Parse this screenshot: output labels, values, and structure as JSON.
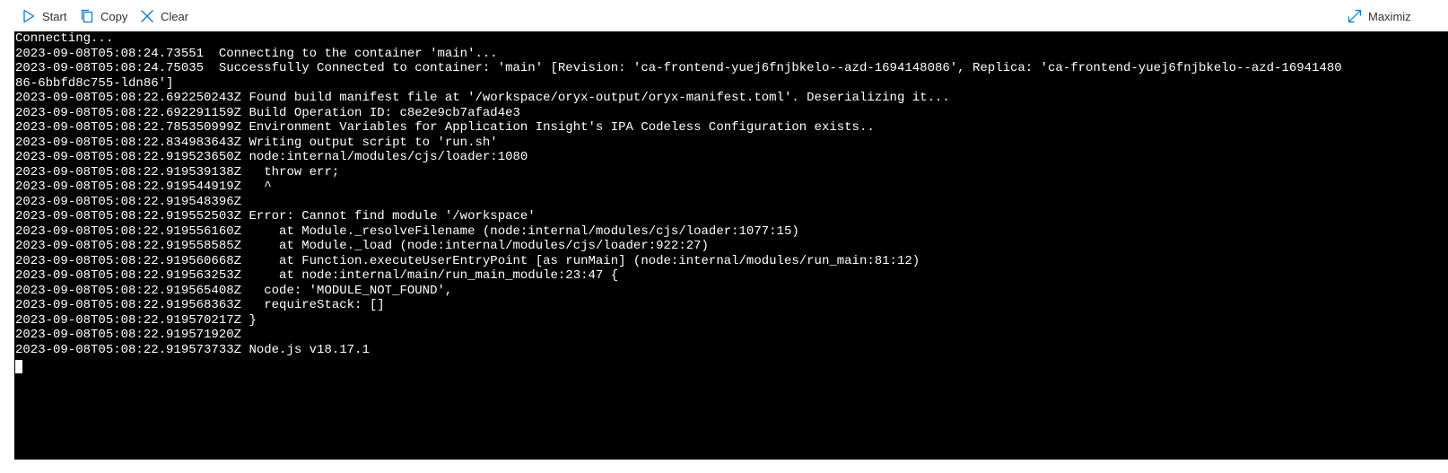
{
  "toolbar": {
    "start_label": "Start",
    "copy_label": "Copy",
    "clear_label": "Clear",
    "maximize_label": "Maximiz"
  },
  "icons": {
    "start": "play-icon",
    "copy": "copy-icon",
    "clear": "close-icon",
    "maximize": "expand-icon"
  },
  "colors": {
    "accent": "#0078d4",
    "console_background": "#000000",
    "console_text": "#ffffff"
  },
  "console": {
    "lines": [
      "Connecting...",
      "2023-09-08T05:08:24.73551  Connecting to the container 'main'...",
      "2023-09-08T05:08:24.75035  Successfully Connected to container: 'main' [Revision: 'ca-frontend-yuej6fnjbkelo--azd-1694148086', Replica: 'ca-frontend-yuej6fnjbkelo--azd-16941480",
      "86-6bbfd8c755-ldn86']",
      "2023-09-08T05:08:22.692250243Z Found build manifest file at '/workspace/oryx-output/oryx-manifest.toml'. Deserializing it...",
      "2023-09-08T05:08:22.692291159Z Build Operation ID: c8e2e9cb7afad4e3",
      "2023-09-08T05:08:22.785350999Z Environment Variables for Application Insight's IPA Codeless Configuration exists..",
      "2023-09-08T05:08:22.834983643Z Writing output script to 'run.sh'",
      "2023-09-08T05:08:22.919523650Z node:internal/modules/cjs/loader:1080",
      "2023-09-08T05:08:22.919539138Z   throw err;",
      "2023-09-08T05:08:22.919544919Z   ^",
      "2023-09-08T05:08:22.919548396Z",
      "2023-09-08T05:08:22.919552503Z Error: Cannot find module '/workspace'",
      "2023-09-08T05:08:22.919556160Z     at Module._resolveFilename (node:internal/modules/cjs/loader:1077:15)",
      "2023-09-08T05:08:22.919558585Z     at Module._load (node:internal/modules/cjs/loader:922:27)",
      "2023-09-08T05:08:22.919560668Z     at Function.executeUserEntryPoint [as runMain] (node:internal/modules/run_main:81:12)",
      "2023-09-08T05:08:22.919563253Z     at node:internal/main/run_main_module:23:47 {",
      "2023-09-08T05:08:22.919565408Z   code: 'MODULE_NOT_FOUND',",
      "2023-09-08T05:08:22.919568363Z   requireStack: []",
      "2023-09-08T05:08:22.919570217Z }",
      "2023-09-08T05:08:22.919571920Z",
      "2023-09-08T05:08:22.919573733Z Node.js v18.17.1"
    ]
  }
}
